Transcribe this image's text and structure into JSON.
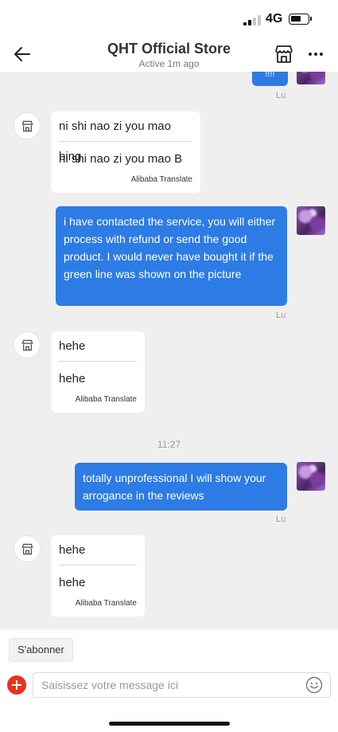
{
  "status_bar": {
    "network": "4G"
  },
  "header": {
    "title": "QHT Official Store",
    "subtitle": "Active 1m ago"
  },
  "chat": {
    "partial_bubble_text": "!!!!",
    "messages": [
      {
        "sender": "Lu"
      },
      {
        "original": "ni shi nao zi you mao bing",
        "translation": "ni shi nao zi you mao B",
        "provider": "Alibaba Translate"
      },
      {
        "text": "i have contacted the service, you will either process with refund or send the good product. I would never have bought it if the green line was shown on the picture",
        "sender": "Lu"
      },
      {
        "original": "hehe",
        "translation": "hehe",
        "provider": "Alibaba Translate"
      },
      {
        "time": "11:27"
      },
      {
        "text": "totally unprofessional I will show your arrogance in the reviews",
        "sender": "Lu"
      },
      {
        "original": "hehe",
        "translation": "hehe",
        "provider": "Alibaba Translate"
      }
    ]
  },
  "bottom": {
    "subscribe_label": "S'abonner",
    "input_placeholder": "Saisissez votre message ici"
  },
  "icons": {
    "back": "arrow-left-icon",
    "store": "store-icon",
    "more": "more-horizontal-icon",
    "add": "plus-circle-icon",
    "emoji": "smiley-icon",
    "seller_avatar": "store-icon"
  },
  "colors": {
    "outgoing_bubble": "#2d7be5",
    "chat_background": "#efefef",
    "add_button": "#e8341b"
  }
}
